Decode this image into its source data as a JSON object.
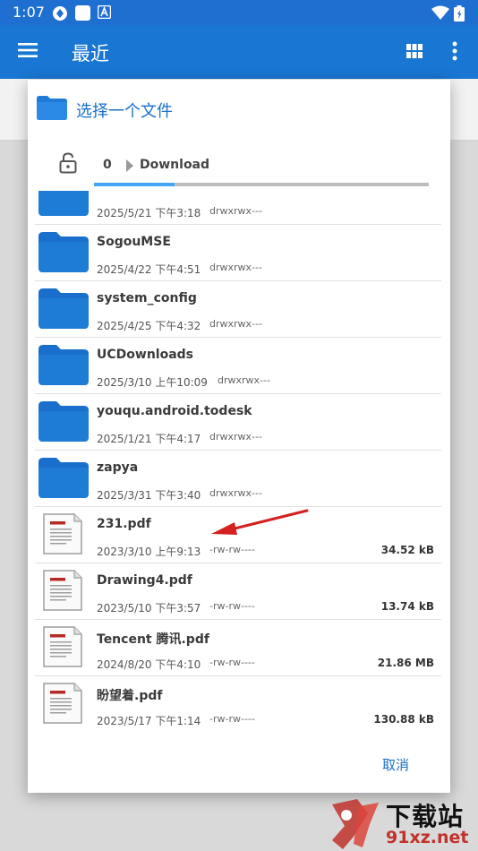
{
  "status_bar": {
    "time": "1:07"
  },
  "app_bar": {
    "title": "最近",
    "menu_icon": "hamburger-menu-icon",
    "grid_icon": "grid-view-icon",
    "more_icon": "more-vert-icon"
  },
  "dialog": {
    "title": "选择一个文件",
    "path": {
      "root": "0",
      "current": "Download"
    },
    "scroll_progress": 0.24,
    "files": [
      {
        "name": "",
        "date": "2025/5/21 下午3:18",
        "perm": "drwxrwx---",
        "size": "",
        "type": "folder"
      },
      {
        "name": "SogouMSE",
        "date": "2025/4/22 下午4:51",
        "perm": "drwxrwx---",
        "size": "",
        "type": "folder"
      },
      {
        "name": "system_config",
        "date": "2025/4/25 下午4:32",
        "perm": "drwxrwx---",
        "size": "",
        "type": "folder"
      },
      {
        "name": "UCDownloads",
        "date": "2025/3/10 上午10:09",
        "perm": "drwxrwx---",
        "size": "",
        "type": "folder"
      },
      {
        "name": "youqu.android.todesk",
        "date": "2025/1/21 下午4:17",
        "perm": "drwxrwx---",
        "size": "",
        "type": "folder"
      },
      {
        "name": "zapya",
        "date": "2025/3/31 下午3:40",
        "perm": "drwxrwx---",
        "size": "",
        "type": "folder"
      },
      {
        "name": "231.pdf",
        "date": "2023/3/10 上午9:13",
        "perm": "-rw-rw----",
        "size": "34.52 kB",
        "type": "pdf"
      },
      {
        "name": "Drawing4.pdf",
        "date": "2023/5/10 下午3:57",
        "perm": "-rw-rw----",
        "size": "13.74 kB",
        "type": "pdf"
      },
      {
        "name": "Tencent 腾讯.pdf",
        "date": "2024/8/20 下午4:10",
        "perm": "-rw-rw----",
        "size": "21.86 MB",
        "type": "pdf"
      },
      {
        "name": "盼望着.pdf",
        "date": "2023/5/17 下午1:14",
        "perm": "-rw-rw----",
        "size": "130.88 kB",
        "type": "pdf"
      }
    ],
    "cancel_label": "取消"
  },
  "watermark": {
    "title": "下载站",
    "domain": "91xz.net"
  },
  "colors": {
    "app_bar": "#1976d2",
    "status_bar": "#1f6fd0",
    "folder": "#1e7bd6",
    "accent_text": "#1a6fc9",
    "annotation_arrow": "#d42020"
  }
}
